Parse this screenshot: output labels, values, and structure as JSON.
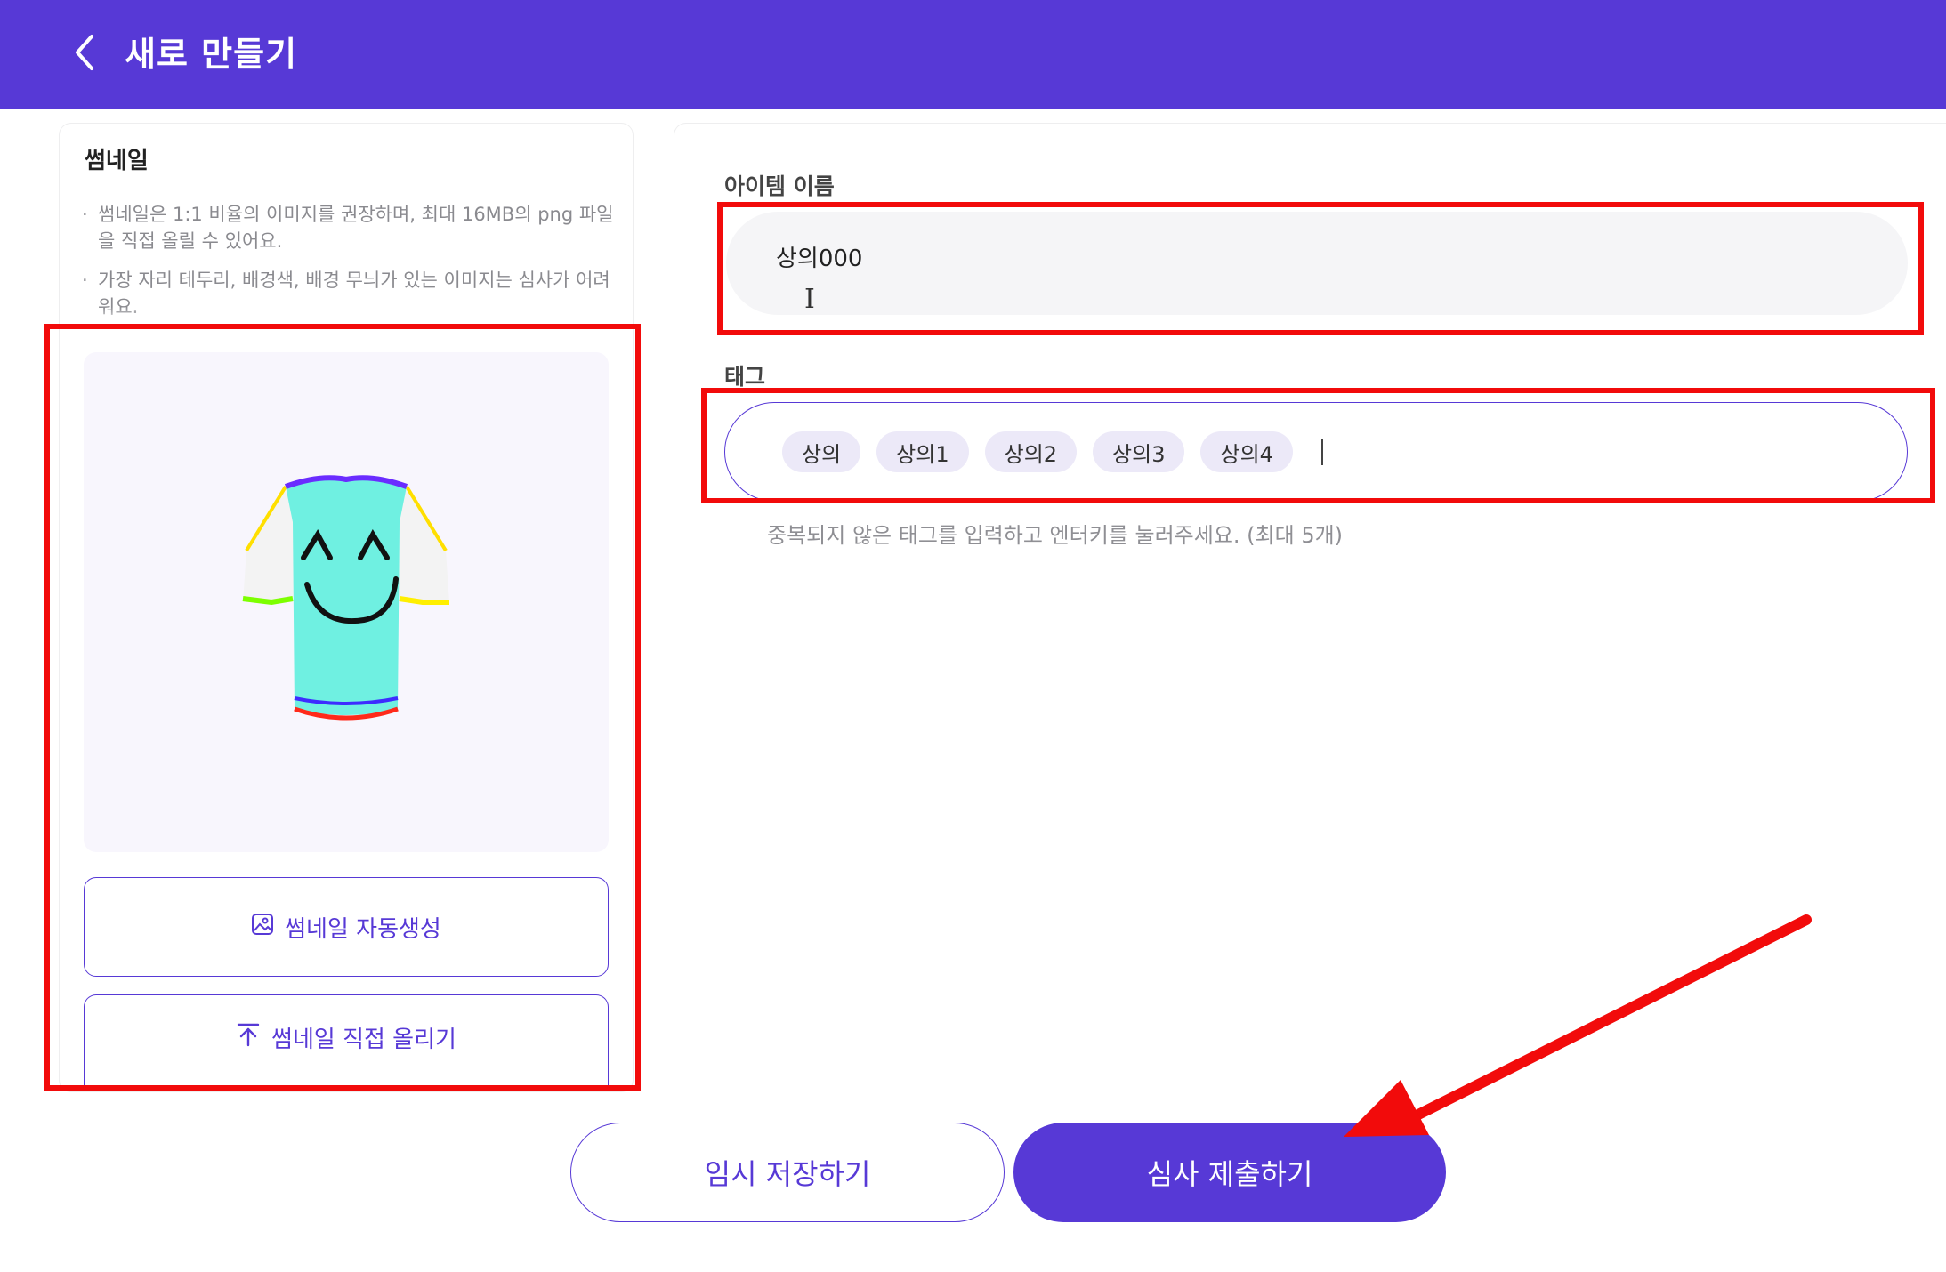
{
  "colors": {
    "accent": "#5739d6",
    "annotation": "#f20b0b"
  },
  "header": {
    "back_icon": "chevron-left-icon",
    "title": "새로 만들기"
  },
  "thumbnail": {
    "section_title": "썸네일",
    "guides": [
      "썸네일은 1:1 비율의 이미지를 권장하며, 최대 16MB의 png 파일을 직접 올릴 수 있어요.",
      "가장 자리 테두리, 배경색, 배경 무늬가 있는 이미지는 심사가 어려워요."
    ],
    "preview_image": "t-shirt-smiley-image",
    "auto_generate_label": "썸네일 자동생성",
    "auto_generate_icon": "image-icon",
    "upload_label": "썸네일 직접 올리기",
    "upload_icon": "upload-icon"
  },
  "form": {
    "name_label": "아이템 이름",
    "name_value": "상의000",
    "tag_label": "태그",
    "tags": [
      "상의",
      "상의1",
      "상의2",
      "상의3",
      "상의4"
    ],
    "tag_help": "중복되지 않은 태그를 입력하고 엔터키를 눌러주세요. (최대 5개)"
  },
  "actions": {
    "save_draft_label": "임시 저장하기",
    "submit_label": "심사 제출하기"
  }
}
